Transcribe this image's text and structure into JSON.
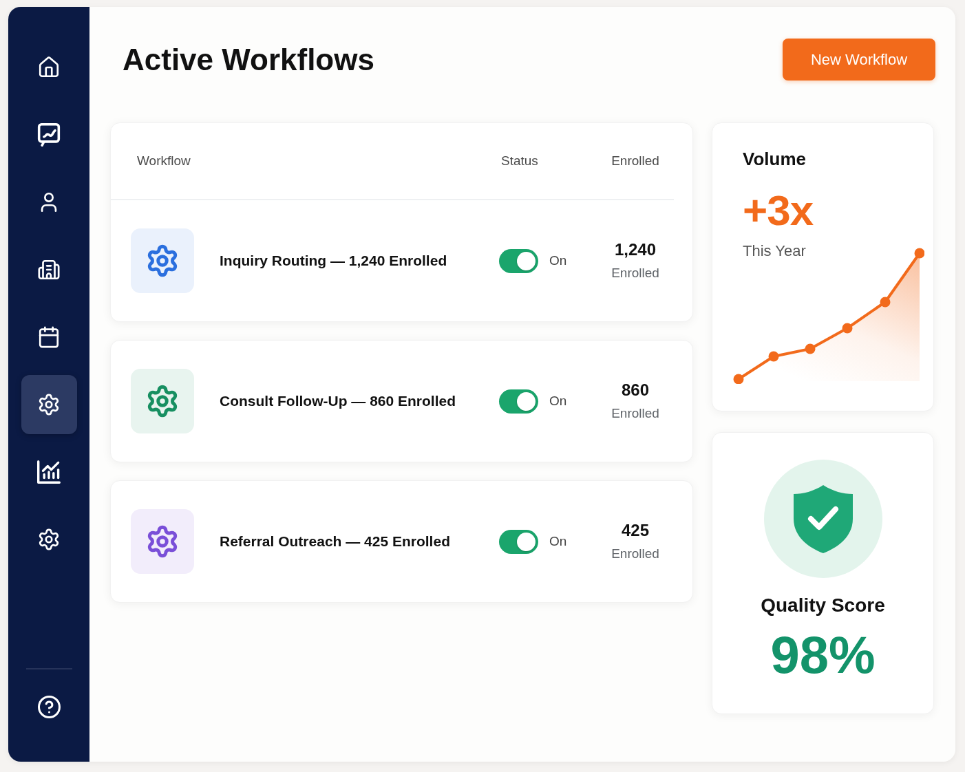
{
  "sidebar": {
    "items": [
      {
        "selected": false
      },
      {
        "selected": false
      },
      {
        "selected": false
      },
      {
        "selected": false
      },
      {
        "selected": false
      },
      {
        "selected": true
      },
      {
        "selected": false
      },
      {
        "selected": false
      }
    ]
  },
  "header": {
    "title": "Active Workflows",
    "button": "New Workflow"
  },
  "workflows": {
    "columns": [
      "Workflow",
      "Status",
      "Enrolled"
    ],
    "rows": [
      {
        "name": "Inquiry Routing — 1,240 Enrolled",
        "color": "#2b6fde",
        "on": true,
        "status": "On",
        "count": "1,240",
        "count_label": "Enrolled"
      },
      {
        "name": "Consult Follow-Up — 860 Enrolled",
        "color": "#178f61",
        "on": true,
        "status": "On",
        "count": "860",
        "count_label": "Enrolled"
      },
      {
        "name": "Referral Outreach — 425 Enrolled",
        "color": "#7a4fd8",
        "on": true,
        "status": "On",
        "count": "425",
        "count_label": "Enrolled"
      }
    ]
  },
  "volume": {
    "title": "Volume",
    "value": "+3x",
    "caption": "This Year"
  },
  "quality": {
    "title": "Quality Score",
    "value": "98%"
  }
}
